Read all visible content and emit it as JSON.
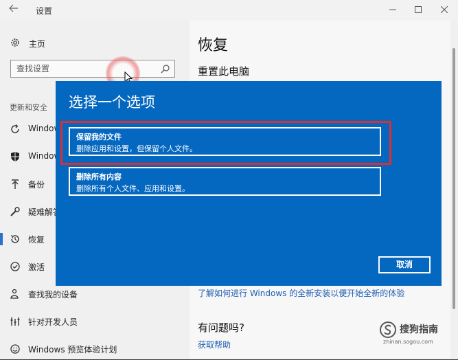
{
  "window": {
    "title": "设置"
  },
  "sidebar": {
    "home_label": "主页",
    "search_placeholder": "查找设置",
    "section_label": "更新和安全",
    "items": [
      {
        "label": "Windows",
        "icon": "sync-icon"
      },
      {
        "label": "Windows",
        "icon": "shield-icon"
      },
      {
        "label": "备份",
        "icon": "upload-arrow-icon"
      },
      {
        "label": "疑难解答",
        "icon": "wrench-icon"
      },
      {
        "label": "恢复",
        "icon": "history-icon",
        "active": true
      },
      {
        "label": "激活",
        "icon": "check-circle-icon"
      },
      {
        "label": "查找我的设备",
        "icon": "person-pin-icon"
      },
      {
        "label": "针对开发人员",
        "icon": "developer-icon"
      },
      {
        "label": "Windows 预览体验计划",
        "icon": "smiley-icon"
      }
    ]
  },
  "main": {
    "title": "恢复",
    "section_reset": "重置此电脑",
    "learn_link": "了解如何进行 Windows 的全新安装以便开始全新的体验",
    "questions_title": "有问题吗?",
    "help_link": "获取帮助"
  },
  "dialog": {
    "title": "选择一个选项",
    "options": [
      {
        "title": "保留我的文件",
        "desc": "删除应用和设置，但保留个人文件。"
      },
      {
        "title": "删除所有内容",
        "desc": "删除所有个人文件、应用和设置。"
      }
    ],
    "cancel_label": "取消"
  },
  "watermark": {
    "text": "搜狗指南",
    "sub": "zhinan.sogou.com"
  },
  "colors": {
    "dialog_bg": "#0467c0",
    "highlight": "#e02d2d",
    "link": "#1e5fb4",
    "active_bar": "#2a73c9"
  }
}
